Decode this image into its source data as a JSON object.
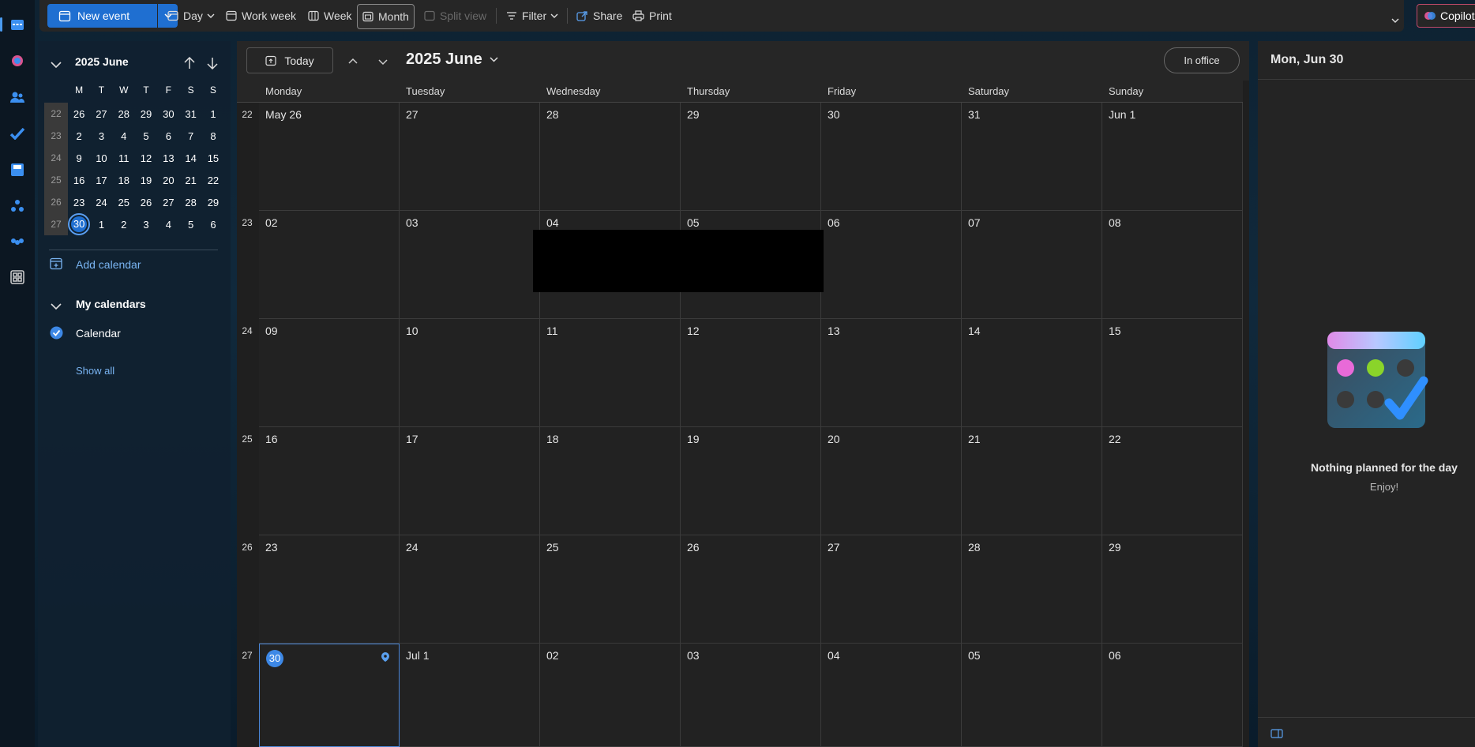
{
  "toolbar": {
    "new_event": "New event",
    "day": "Day",
    "work_week": "Work week",
    "week": "Week",
    "month": "Month",
    "split_view": "Split view",
    "filter": "Filter",
    "share": "Share",
    "print": "Print",
    "copilot": "Copilot"
  },
  "mini_calendar": {
    "title": "2025 June",
    "weekday_headers": [
      "M",
      "T",
      "W",
      "T",
      "F",
      "S",
      "S"
    ],
    "weeks": [
      {
        "num": "22",
        "days": [
          "26",
          "27",
          "28",
          "29",
          "30",
          "31",
          "1"
        ]
      },
      {
        "num": "23",
        "days": [
          "2",
          "3",
          "4",
          "5",
          "6",
          "7",
          "8"
        ]
      },
      {
        "num": "24",
        "days": [
          "9",
          "10",
          "11",
          "12",
          "13",
          "14",
          "15"
        ]
      },
      {
        "num": "25",
        "days": [
          "16",
          "17",
          "18",
          "19",
          "20",
          "21",
          "22"
        ]
      },
      {
        "num": "26",
        "days": [
          "23",
          "24",
          "25",
          "26",
          "27",
          "28",
          "29"
        ]
      },
      {
        "num": "27",
        "days": [
          "30",
          "1",
          "2",
          "3",
          "4",
          "5",
          "6"
        ]
      }
    ],
    "today": "30"
  },
  "left_pane": {
    "add_calendar": "Add calendar",
    "my_calendars": "My calendars",
    "calendar_item": "Calendar",
    "show_all": "Show all"
  },
  "calendar": {
    "today_button": "Today",
    "month_title": "2025 June",
    "in_office": "In office",
    "day_headers": [
      "Monday",
      "Tuesday",
      "Wednesday",
      "Thursday",
      "Friday",
      "Saturday",
      "Sunday"
    ],
    "weeks": [
      {
        "num": "22",
        "days": [
          "May 26",
          "27",
          "28",
          "29",
          "30",
          "31",
          "Jun 1"
        ]
      },
      {
        "num": "23",
        "days": [
          "02",
          "03",
          "04",
          "05",
          "06",
          "07",
          "08"
        ]
      },
      {
        "num": "24",
        "days": [
          "09",
          "10",
          "11",
          "12",
          "13",
          "14",
          "15"
        ]
      },
      {
        "num": "25",
        "days": [
          "16",
          "17",
          "18",
          "19",
          "20",
          "21",
          "22"
        ]
      },
      {
        "num": "26",
        "days": [
          "23",
          "24",
          "25",
          "26",
          "27",
          "28",
          "29"
        ]
      },
      {
        "num": "27",
        "days": [
          "30",
          "Jul 1",
          "02",
          "03",
          "04",
          "05",
          "06"
        ]
      }
    ]
  },
  "right_pane": {
    "date_title": "Mon, Jun 30",
    "empty_title": "Nothing planned for the day",
    "empty_sub": "Enjoy!"
  },
  "colors": {
    "accent": "#1f6fd1",
    "today": "#3d88e6"
  }
}
